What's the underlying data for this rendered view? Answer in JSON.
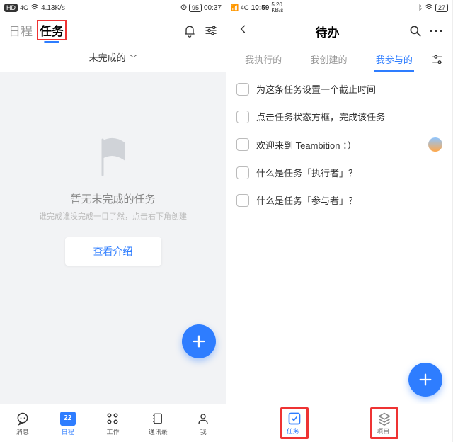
{
  "left": {
    "status": {
      "net": "HD",
      "sig": "4G",
      "wifi": "⚫",
      "speed": "4.13K/s",
      "eye": "⚯",
      "batt": "95",
      "time": "00:37"
    },
    "tabs": {
      "schedule": "日程",
      "task": "任务"
    },
    "filter": "未完成的",
    "empty": {
      "title": "暂无未完成的任务",
      "sub": "谁完成谁没完成一目了然，点击右下角创建",
      "btn": "查看介绍"
    },
    "nav": {
      "msg": "消息",
      "cal": "日程",
      "cal_num": "22",
      "work": "工作",
      "contacts": "通讯录",
      "me": "我"
    }
  },
  "right": {
    "status": {
      "sig": "4G",
      "time": "10:59",
      "speed": "5.20",
      "speedu": "KB/s",
      "bt": "⚪",
      "wifi": "⚫",
      "batt": "27"
    },
    "title": "待办",
    "tabs": {
      "executor": "我执行的",
      "creator": "我创建的",
      "participant": "我参与的"
    },
    "tasks": [
      "为这条任务设置一个截止时间",
      "点击任务状态方框，完成该任务",
      "欢迎来到 Teambition ：）",
      "什么是任务「执行者」？",
      "什么是任务「参与者」？"
    ],
    "nav": {
      "todo": "任务",
      "proj": "项目"
    }
  }
}
